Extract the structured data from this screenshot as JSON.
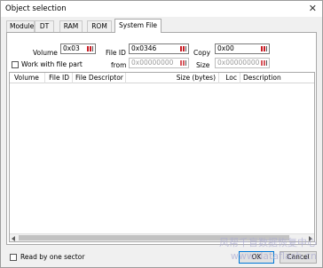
{
  "window": {
    "title": "Object selection",
    "close_glyph": "✕"
  },
  "tabs": [
    {
      "label": "Module",
      "active": false
    },
    {
      "label": "DT",
      "active": false
    },
    {
      "label": "RAM",
      "active": false
    },
    {
      "label": "ROM",
      "active": false
    },
    {
      "label": "System File",
      "active": true
    }
  ],
  "form": {
    "volume_label": "Volume",
    "volume_value": "0x03",
    "file_id_label": "File ID",
    "file_id_value": "0x0346",
    "copy_label": "Copy",
    "copy_value": "0x00",
    "work_with_file_part_label": "Work with file part",
    "from_label": "from",
    "from_value": "0x00000000",
    "size_label": "Size",
    "size_value": "0x00000000"
  },
  "table": {
    "columns": [
      "Volume",
      "File ID",
      "File Descriptor",
      "Size (bytes)",
      "Loc",
      "Description"
    ],
    "rows": []
  },
  "footer": {
    "read_by_one_sector_label": "Read by one sector",
    "ok_label": "OK",
    "cancel_label": "Cancel"
  },
  "watermark": {
    "line1": "风帮千盲数据恢复中心",
    "line2": "www.dataflash.cn"
  },
  "colors": {
    "accent": "#0078d7",
    "button_icon": "#c81d25"
  }
}
